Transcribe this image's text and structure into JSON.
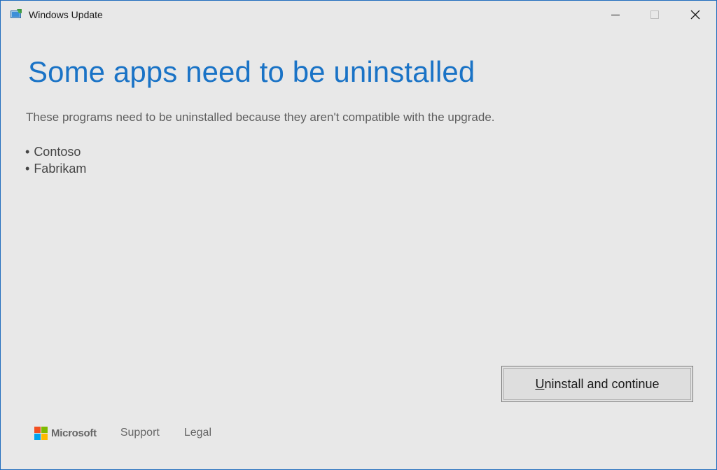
{
  "window": {
    "title": "Windows Update",
    "app_icon": "windows-update-icon",
    "controls": {
      "minimize_icon": "minimize-icon",
      "maximize_icon": "maximize-icon",
      "close_icon": "close-icon"
    }
  },
  "main": {
    "heading": "Some apps need to be uninstalled",
    "description": "These programs need to be uninstalled because they aren't compatible with the upgrade.",
    "apps": [
      {
        "bullet": "•",
        "name": "Contoso"
      },
      {
        "bullet": "•",
        "name": "Fabrikam"
      }
    ]
  },
  "actions": {
    "primary_button": {
      "label_access_key": "U",
      "label_rest": "ninstall and continue"
    }
  },
  "footer": {
    "brand": "Microsoft",
    "support_label": "Support",
    "legal_label": "Legal"
  },
  "colors": {
    "heading": "#1a73c6",
    "window_border": "#1e6bbd",
    "background": "#e8e8e8",
    "ms_red": "#f25022",
    "ms_green": "#7fba00",
    "ms_blue": "#00a4ef",
    "ms_yellow": "#ffb900"
  }
}
